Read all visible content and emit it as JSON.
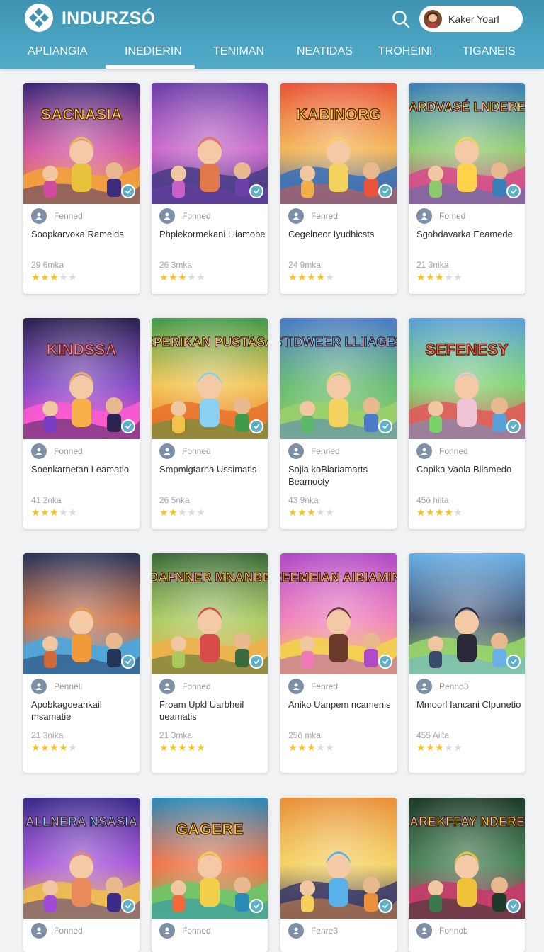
{
  "app": {
    "brand": "INDURZSÓ",
    "user_name": "Kaker Yoarl"
  },
  "tabs": [
    "APLIANGIA",
    "INEDIERIN",
    "TENIMAN",
    "NEATIDAS",
    "TROHEINI",
    "TIGANEIS"
  ],
  "active_tab": "INEDIERIN",
  "colors": {
    "header": "#4aa3c2",
    "star": "#f5c11f",
    "badge": "#5fb0c7"
  },
  "games": [
    {
      "art_title": "SACNASIA",
      "dev": "Fenned",
      "title": "Soopkarvoka Ramelds",
      "meta": "29 6mka",
      "rating": 3
    },
    {
      "art_title": "",
      "dev": "Fonned",
      "title": "Phplekormekani Liiamobe",
      "meta": "26 3mka",
      "rating": 3
    },
    {
      "art_title": "KABINORG",
      "dev": "Fenred",
      "title": "Cegelneor Iyudhicsts",
      "meta": "24 9mka",
      "rating": 4
    },
    {
      "art_title": "DARDVASÉ LNDERES",
      "dev": "Fomed",
      "title": "Sgohdavarka Eeamede",
      "meta": "21 3nika",
      "rating": 3
    },
    {
      "art_title": "KINDSSA",
      "dev": "Fonned",
      "title": "Soenkarnetan Leamatio",
      "meta": "41 2nka",
      "rating": 3
    },
    {
      "art_title": "EPERIKAN PUSTASA",
      "dev": "Fonned",
      "title": "Smpmigtarha Ussimatis",
      "meta": "26 5nka",
      "rating": 2
    },
    {
      "art_title": "STIDWEER LLIIAGES",
      "dev": "Fenned",
      "title": "Sojia koBlariamarts Beamocty",
      "meta": "43 9nka",
      "rating": 3
    },
    {
      "art_title": "SEFENESY",
      "dev": "Fonned",
      "title": "Copika Vaola Bllamedo",
      "meta": "45ô hiita",
      "rating": 4
    },
    {
      "art_title": "",
      "dev": "Pennell",
      "title": "Apobkagoeahkail msamatie",
      "meta": "21 3nika",
      "rating": 4
    },
    {
      "art_title": "COAFNNER MNANBEA",
      "dev": "Fonned",
      "title": "Froam Upkl Uarbheil ueamatis",
      "meta": "21 3mka",
      "rating": 5
    },
    {
      "art_title": "PREEMEIAN AIBIAMINIA",
      "dev": "Fenred",
      "title": "Aniko Uanpem ncamenis",
      "meta": "25ô mka",
      "rating": 3
    },
    {
      "art_title": "",
      "dev": "Penno3",
      "title": "Mmoorl Iancani Clpunetio",
      "meta": "455 Aiita",
      "rating": 3
    },
    {
      "art_title": "ALLNERA NSASIA",
      "dev": "Fonned",
      "title": "",
      "meta": "",
      "rating": 0
    },
    {
      "art_title": "GAGERE",
      "dev": "Fonned",
      "title": "",
      "meta": "",
      "rating": 0
    },
    {
      "art_title": "",
      "dev": "Fenre3",
      "title": "",
      "meta": "",
      "rating": 0
    },
    {
      "art_title": "DAREKFFAY NDERES",
      "dev": "Fonnob",
      "title": "",
      "meta": "",
      "rating": 0
    }
  ]
}
